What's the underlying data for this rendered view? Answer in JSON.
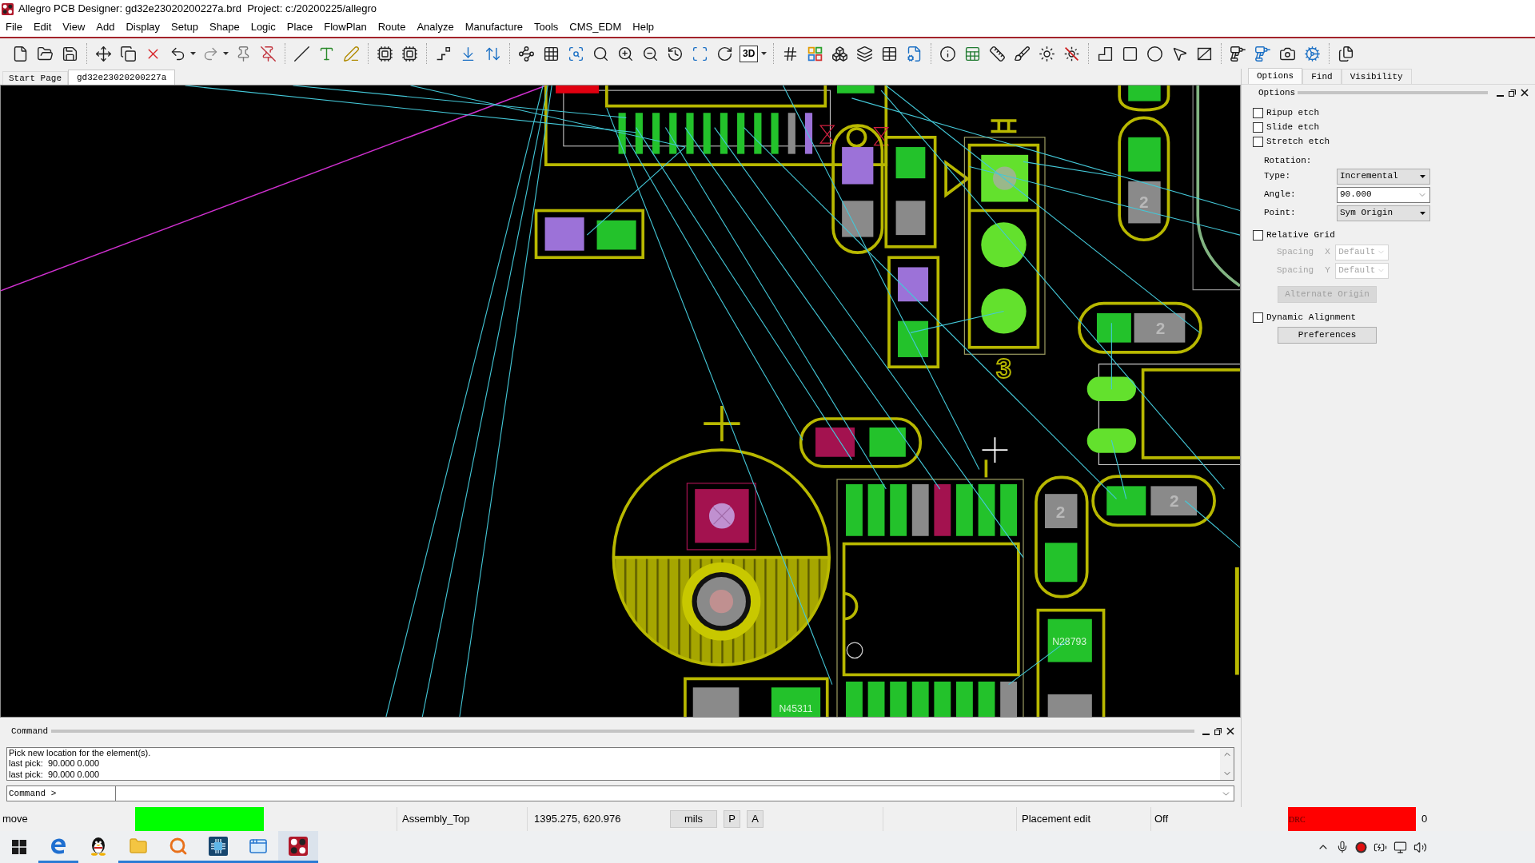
{
  "window": {
    "title": "Allegro PCB Designer: gd32e23020200227a.brd  Project: c:/20200225/allegro"
  },
  "menu": [
    "File",
    "Edit",
    "View",
    "Add",
    "Display",
    "Setup",
    "Shape",
    "Logic",
    "Place",
    "FlowPlan",
    "Route",
    "Analyze",
    "Manufacture",
    "Tools",
    "CMS_EDM",
    "Help"
  ],
  "toolbar": {
    "view_3d": "3D"
  },
  "document_tabs": [
    {
      "label": "Start Page",
      "selected": false
    },
    {
      "label": "gd32e23020200227a",
      "selected": true
    }
  ],
  "canvas": {
    "refdes_label": "3",
    "pin_labels": [
      "2",
      "2",
      "2",
      "2"
    ],
    "net_labels": [
      "N28793",
      "N45311"
    ]
  },
  "options_panel": {
    "tabs": [
      {
        "label": "Options",
        "selected": true
      },
      {
        "label": "Find",
        "selected": false
      },
      {
        "label": "Visibility",
        "selected": false
      }
    ],
    "title": "Options",
    "etch_options": [
      {
        "label": "Ripup etch",
        "checked": false
      },
      {
        "label": "Slide etch",
        "checked": false
      },
      {
        "label": "Stretch etch",
        "checked": false
      }
    ],
    "rotation": {
      "heading": "Rotation:",
      "fields": [
        {
          "label": "Type:",
          "value": "Incremental",
          "kind": "dropdown"
        },
        {
          "label": "Angle:",
          "value": "90.000",
          "kind": "combo"
        },
        {
          "label": "Point:",
          "value": "Sym Origin",
          "kind": "dropdown"
        }
      ]
    },
    "relative_grid": {
      "label": "Relative Grid",
      "checked": false,
      "spacing": [
        {
          "label": "Spacing",
          "axis": "X",
          "value": "Default",
          "disabled": true
        },
        {
          "label": "Spacing",
          "axis": "Y",
          "value": "Default",
          "disabled": true
        }
      ],
      "alternate_origin": {
        "label": "Alternate Origin",
        "disabled": true
      }
    },
    "dynamic_alignment": {
      "label": "Dynamic Alignment",
      "checked": false
    },
    "preferences": "Preferences"
  },
  "command_window": {
    "title": "Command",
    "log": [
      "Pick new location for the element(s).",
      "last pick:  90.000 0.000",
      "last pick:  90.000 0.000"
    ],
    "prompt": "Command >"
  },
  "status_bar": {
    "mode": "move",
    "ready": true,
    "layer": "Assembly_Top",
    "coordinates": "1395.275, 620.976",
    "units": "mils",
    "toggles": [
      "P",
      "A"
    ],
    "edit_mode": "Placement edit",
    "snap": "Off",
    "drc": {
      "label": "DRC",
      "up_to_date": false,
      "count": "0"
    }
  },
  "taskbar": {
    "apps": [
      {
        "running": true,
        "active": false
      },
      {
        "running": false,
        "active": false
      },
      {
        "running": true,
        "active": false
      },
      {
        "running": true,
        "active": false
      },
      {
        "running": true,
        "active": false
      },
      {
        "running": true,
        "active": false
      },
      {
        "running": true,
        "active": true
      }
    ]
  }
}
